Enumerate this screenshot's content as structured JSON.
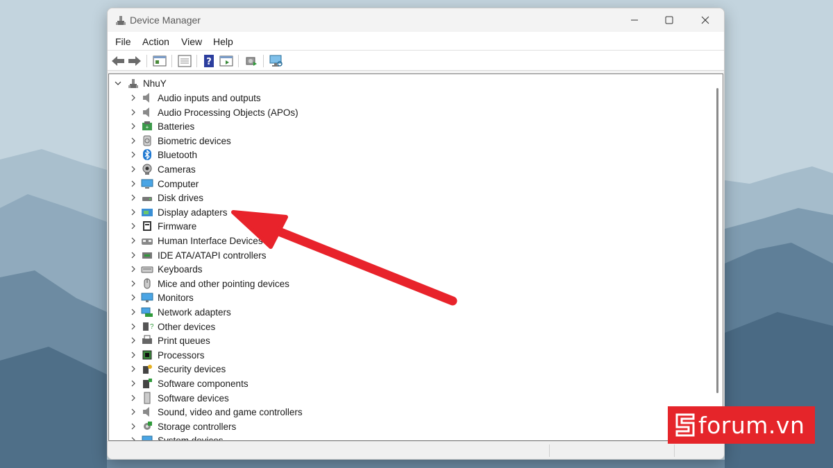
{
  "window": {
    "title": "Device Manager",
    "accent_color": "#0067c0"
  },
  "menubar": {
    "items": [
      "File",
      "Action",
      "View",
      "Help"
    ]
  },
  "toolbar": {
    "buttons": [
      "back-icon",
      "forward-icon",
      "properties-icon",
      "show-hide-tree-icon",
      "help-icon",
      "action-pane-icon",
      "update-driver-icon",
      "scan-hardware-icon"
    ]
  },
  "tree": {
    "root": "NhuY",
    "categories": [
      "Audio inputs and outputs",
      "Audio Processing Objects (APOs)",
      "Batteries",
      "Biometric devices",
      "Bluetooth",
      "Cameras",
      "Computer",
      "Disk drives",
      "Display adapters",
      "Firmware",
      "Human Interface Devices",
      "IDE ATA/ATAPI controllers",
      "Keyboards",
      "Mice and other pointing devices",
      "Monitors",
      "Network adapters",
      "Other devices",
      "Print queues",
      "Processors",
      "Security devices",
      "Software components",
      "Software devices",
      "Sound, video and game controllers",
      "Storage controllers",
      "System devices"
    ],
    "highlighted": "Display adapters"
  },
  "annotation": {
    "arrow_color": "#e8232b"
  },
  "watermark": {
    "text": "forum.vn",
    "color": "#e5252a"
  }
}
